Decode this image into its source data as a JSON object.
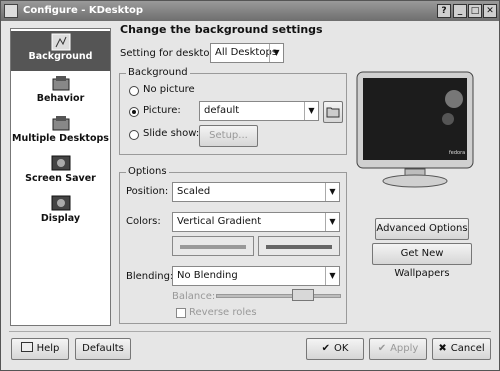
{
  "window": {
    "title": "Configure - KDesktop"
  },
  "titlebar_buttons": [
    "?",
    "_",
    "□",
    "✕"
  ],
  "sidebar": {
    "items": [
      {
        "label": "Background",
        "icon": "background-icon",
        "selected": true
      },
      {
        "label": "Behavior",
        "icon": "behavior-icon"
      },
      {
        "label": "Multiple Desktops",
        "icon": "multiple-desktops-icon"
      },
      {
        "label": "Screen Saver",
        "icon": "screen-saver-icon"
      },
      {
        "label": "Display",
        "icon": "display-icon"
      }
    ]
  },
  "main": {
    "heading": "Change the background settings",
    "setting_for_desktop_label": "Setting for desktop:",
    "desktop_select_value": "All Desktops",
    "background_group": {
      "title": "Background",
      "no_picture": "No picture",
      "picture": "Picture:",
      "picture_value": "default",
      "slide_show": "Slide show:",
      "setup_button": "Setup...",
      "selected": "picture"
    },
    "options_group": {
      "title": "Options",
      "position_label": "Position:",
      "position_value": "Scaled",
      "colors_label": "Colors:",
      "colors_value": "Vertical Gradient",
      "blending_label": "Blending:",
      "blending_value": "No Blending",
      "balance_label": "Balance:",
      "balance_level": 0.7,
      "reverse_roles_label": "Reverse roles",
      "reverse_roles_checked": false
    },
    "preview_logo_text": "fedora",
    "advanced_options_button": "Advanced Options",
    "get_new_wallpapers_button": "Get New Wallpapers"
  },
  "footer": {
    "help": "Help",
    "defaults": "Defaults",
    "ok": "OK",
    "apply": "Apply",
    "cancel": "Cancel"
  }
}
